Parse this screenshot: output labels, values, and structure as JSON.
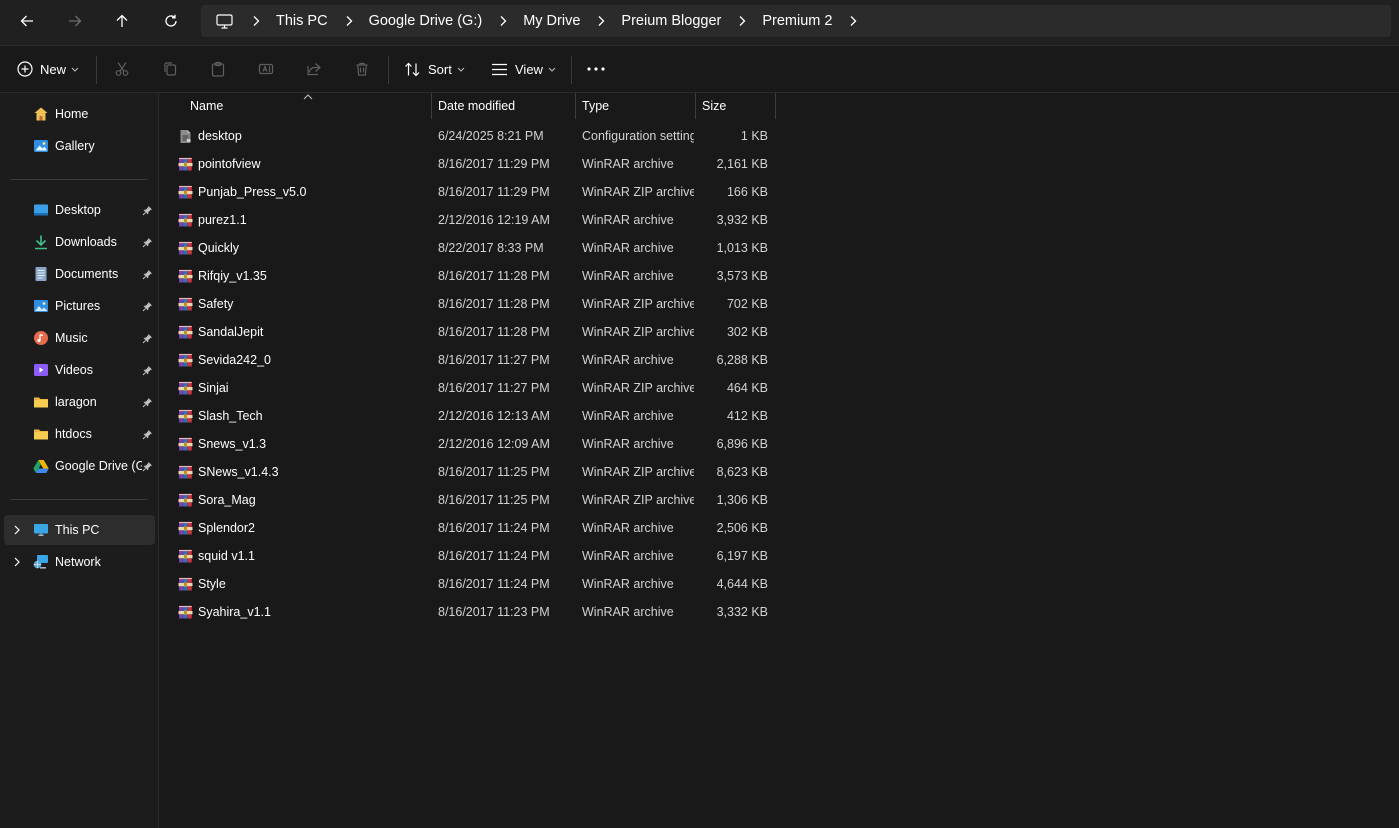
{
  "address_bar": {
    "breadcrumbs": [
      "This PC",
      "Google Drive (G:)",
      "My Drive",
      "Preium Blogger",
      "Premium 2"
    ]
  },
  "toolbar": {
    "new_label": "New",
    "sort_label": "Sort",
    "view_label": "View"
  },
  "sidebar": {
    "quick": [
      {
        "label": "Home",
        "icon": "home-icon"
      },
      {
        "label": "Gallery",
        "icon": "gallery-icon"
      }
    ],
    "pinned": [
      {
        "label": "Desktop",
        "icon": "desktop-folder-icon"
      },
      {
        "label": "Downloads",
        "icon": "downloads-icon"
      },
      {
        "label": "Documents",
        "icon": "documents-icon"
      },
      {
        "label": "Pictures",
        "icon": "pictures-icon"
      },
      {
        "label": "Music",
        "icon": "music-icon"
      },
      {
        "label": "Videos",
        "icon": "videos-icon"
      },
      {
        "label": "laragon",
        "icon": "folder-icon"
      },
      {
        "label": "htdocs",
        "icon": "folder-icon"
      },
      {
        "label": "Google Drive (G:)",
        "icon": "google-drive-icon"
      }
    ],
    "devices": [
      {
        "label": "This PC",
        "icon": "this-pc-icon",
        "selected": true
      },
      {
        "label": "Network",
        "icon": "network-icon"
      }
    ]
  },
  "file_list": {
    "columns": {
      "name": "Name",
      "date": "Date modified",
      "type": "Type",
      "size": "Size"
    },
    "rows": [
      {
        "name": "desktop",
        "date": "6/24/2025 8:21 PM",
        "type": "Configuration settings",
        "size": "1 KB",
        "icon": "config-file-icon"
      },
      {
        "name": "pointofview",
        "date": "8/16/2017 11:29 PM",
        "type": "WinRAR archive",
        "size": "2,161 KB",
        "icon": "winrar-icon"
      },
      {
        "name": "Punjab_Press_v5.0",
        "date": "8/16/2017 11:29 PM",
        "type": "WinRAR ZIP archive",
        "size": "166 KB",
        "icon": "winrar-icon"
      },
      {
        "name": "purez1.1",
        "date": "2/12/2016 12:19 AM",
        "type": "WinRAR archive",
        "size": "3,932 KB",
        "icon": "winrar-icon"
      },
      {
        "name": "Quickly",
        "date": "8/22/2017 8:33 PM",
        "type": "WinRAR archive",
        "size": "1,013 KB",
        "icon": "winrar-icon"
      },
      {
        "name": "Rifqiy_v1.35",
        "date": "8/16/2017 11:28 PM",
        "type": "WinRAR archive",
        "size": "3,573 KB",
        "icon": "winrar-icon"
      },
      {
        "name": "Safety",
        "date": "8/16/2017 11:28 PM",
        "type": "WinRAR ZIP archive",
        "size": "702 KB",
        "icon": "winrar-icon"
      },
      {
        "name": "SandalJepit",
        "date": "8/16/2017 11:28 PM",
        "type": "WinRAR ZIP archive",
        "size": "302 KB",
        "icon": "winrar-icon"
      },
      {
        "name": "Sevida242_0",
        "date": "8/16/2017 11:27 PM",
        "type": "WinRAR archive",
        "size": "6,288 KB",
        "icon": "winrar-icon"
      },
      {
        "name": "Sinjai",
        "date": "8/16/2017 11:27 PM",
        "type": "WinRAR ZIP archive",
        "size": "464 KB",
        "icon": "winrar-icon"
      },
      {
        "name": "Slash_Tech",
        "date": "2/12/2016 12:13 AM",
        "type": "WinRAR archive",
        "size": "412 KB",
        "icon": "winrar-icon"
      },
      {
        "name": "Snews_v1.3",
        "date": "2/12/2016 12:09 AM",
        "type": "WinRAR archive",
        "size": "6,896 KB",
        "icon": "winrar-icon"
      },
      {
        "name": "SNews_v1.4.3",
        "date": "8/16/2017 11:25 PM",
        "type": "WinRAR ZIP archive",
        "size": "8,623 KB",
        "icon": "winrar-icon"
      },
      {
        "name": "Sora_Mag",
        "date": "8/16/2017 11:25 PM",
        "type": "WinRAR ZIP archive",
        "size": "1,306 KB",
        "icon": "winrar-icon"
      },
      {
        "name": "Splendor2",
        "date": "8/16/2017 11:24 PM",
        "type": "WinRAR archive",
        "size": "2,506 KB",
        "icon": "winrar-icon"
      },
      {
        "name": "squid v1.1",
        "date": "8/16/2017 11:24 PM",
        "type": "WinRAR archive",
        "size": "6,197 KB",
        "icon": "winrar-icon"
      },
      {
        "name": "Style",
        "date": "8/16/2017 11:24 PM",
        "type": "WinRAR archive",
        "size": "4,644 KB",
        "icon": "winrar-icon"
      },
      {
        "name": "Syahira_v1.1",
        "date": "8/16/2017 11:23 PM",
        "type": "WinRAR archive",
        "size": "3,332 KB",
        "icon": "winrar-icon"
      }
    ]
  }
}
